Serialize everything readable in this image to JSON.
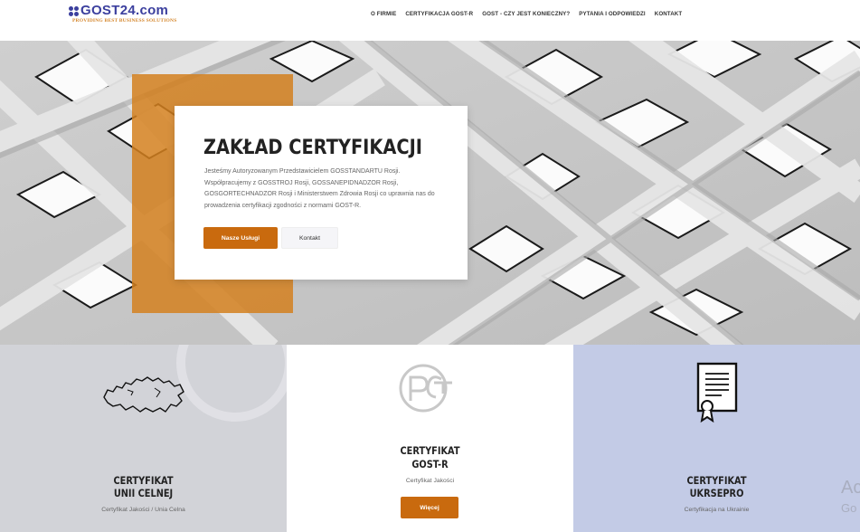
{
  "logo": {
    "main": "GOST24.com",
    "tagline": "PROVIDING BEST BUSINESS SOLUTIONS"
  },
  "nav": [
    {
      "label": "O FIRMIE"
    },
    {
      "label": "CERTYFIKACJA GOST-R"
    },
    {
      "label": "GOST - CZY JEST KONIECZNY?"
    },
    {
      "label": "PYTANIA I ODPOWIEDZI"
    },
    {
      "label": "KONTAKT"
    }
  ],
  "hero": {
    "title": "ZAKŁAD CERTYFIKACJI",
    "description": "Jesteśmy Autoryzowanym Przedstawicielem GOSSTANDARTU Rosji. Współpracujemy z GOSSTROJ Rosji, GOSSANEPIDNADZOR Rosji, GOSGORTECHNADZOR Rosji i Ministerstwem Zdrowia Rosji co uprawnia nas do prowadzenia certyfikacji zgodności z normami GOST-R.",
    "primary_button": "Nasze Usługi",
    "secondary_button": "Kontakt",
    "accent_color": "#c96a0e"
  },
  "cards": [
    {
      "title_line1": "CERTYFIKAT",
      "title_line2": "UNII CELNEJ",
      "subtitle": "Certyfikat Jakości / Unia Celna",
      "icon": "russia-map-icon"
    },
    {
      "title_line1": "CERTYFIKAT",
      "title_line2": "GOST-R",
      "subtitle": "Certyfikat Jakości",
      "button": "Więcej",
      "icon": "rst-mark-icon"
    },
    {
      "title_line1": "CERTYFIKAT",
      "title_line2": "UKRSEPRO",
      "subtitle": "Certyfikacja na Ukrainie",
      "icon": "certificate-icon"
    }
  ],
  "watermark": {
    "line1": "Ac",
    "line2": "Go"
  }
}
